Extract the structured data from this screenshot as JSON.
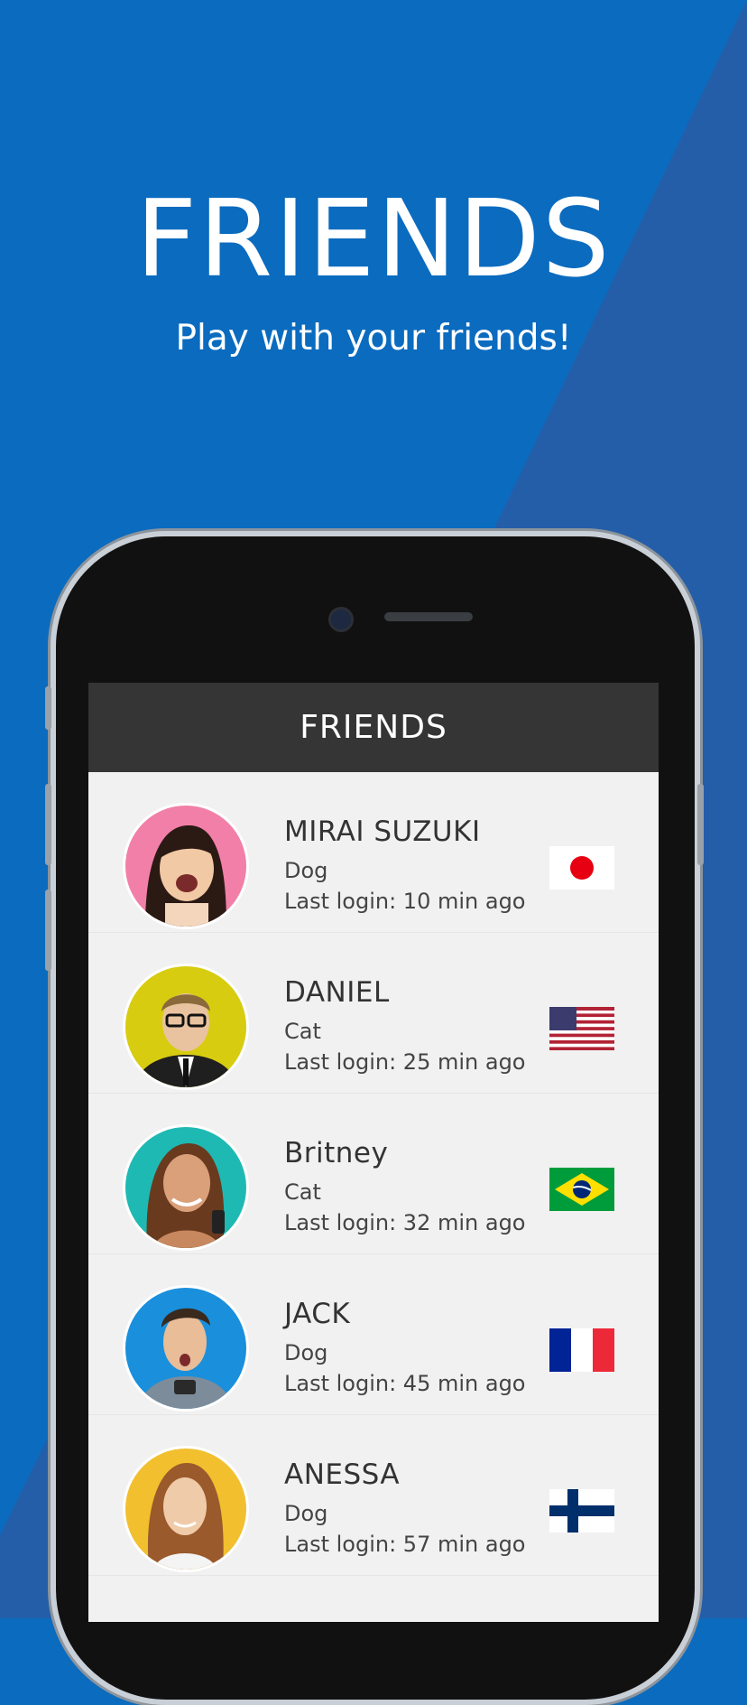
{
  "promo": {
    "title": "FRIENDS",
    "subtitle": "Play with your friends!"
  },
  "app": {
    "header_title": "FRIENDS"
  },
  "friends": [
    {
      "name": "MIRAI SUZUKI",
      "pet": "Dog",
      "last_login": "Last login: 10 min ago",
      "avatar_color": "#f27fa8",
      "flag": "japan-flag-icon"
    },
    {
      "name": "DANIEL",
      "pet": "Cat",
      "last_login": "Last login: 25 min ago",
      "avatar_color": "#d8cc10",
      "flag": "usa-flag-icon"
    },
    {
      "name": "Britney",
      "pet": "Cat",
      "last_login": "Last login: 32 min ago",
      "avatar_color": "#1fb9b4",
      "flag": "brazil-flag-icon"
    },
    {
      "name": "JACK",
      "pet": "Dog",
      "last_login": "Last login: 45 min ago",
      "avatar_color": "#1a8fdc",
      "flag": "france-flag-icon"
    },
    {
      "name": "ANESSA",
      "pet": "Dog",
      "last_login": "Last login: 57 min ago",
      "avatar_color": "#f2bf2e",
      "flag": "finland-flag-icon"
    }
  ],
  "colors": {
    "background": "#0a6bbf",
    "background_diagonal": "#255ea8",
    "app_header": "#353535",
    "list_background": "#f1f1f1"
  }
}
